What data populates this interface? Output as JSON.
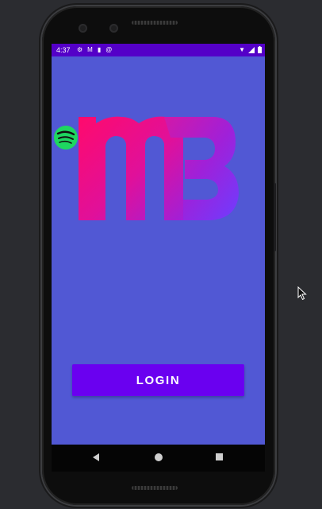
{
  "status_bar": {
    "time": "4:37",
    "left_icons": [
      "gear-icon",
      "gmail-icon",
      "sim-card-icon",
      "at-sign-icon"
    ],
    "right_icons": [
      "wifi-icon",
      "signal-icon",
      "battery-icon"
    ]
  },
  "logo": {
    "text": "MB",
    "colors": {
      "pink": "#ff0a6c",
      "purple": "#a020d8",
      "blue": "#6e3cff"
    },
    "badge": "spotify-icon",
    "badge_color": "#1ed760"
  },
  "login": {
    "label": "LOGIN"
  },
  "navigation": [
    "back-icon",
    "home-icon",
    "recents-icon"
  ],
  "colors": {
    "background": "#5158d4",
    "status_bar": "#5400c8",
    "button": "#6a00f0",
    "nav_bar": "#050505"
  }
}
